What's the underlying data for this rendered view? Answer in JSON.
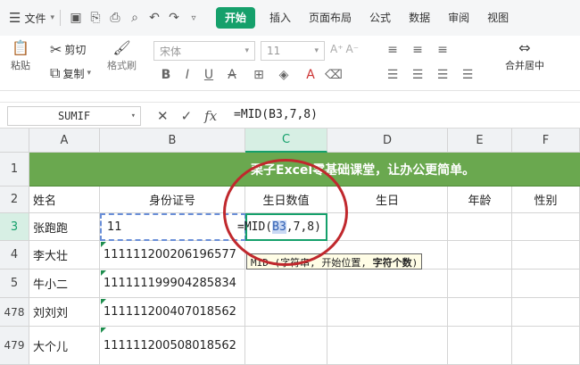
{
  "menu": {
    "file_label": "文件",
    "tabs": [
      "开始",
      "插入",
      "页面布局",
      "公式",
      "数据",
      "审阅",
      "视图"
    ],
    "active_tab": "开始"
  },
  "ribbon": {
    "paste": "粘贴",
    "cut": "剪切",
    "copy": "复制",
    "format_painter": "格式刷",
    "font_name": "宋体",
    "font_size": "11",
    "merge_center": "合并居中"
  },
  "formula_bar": {
    "name_box": "SUMIF",
    "formula": "=MID(B3,7,8)"
  },
  "columns": [
    "A",
    "B",
    "C",
    "D",
    "E",
    "F"
  ],
  "rows": [
    "1",
    "2",
    "3",
    "4",
    "5",
    "478",
    "479"
  ],
  "banner_text": "栗子Excel零基础课堂，让办公更简单。",
  "header_row": {
    "name": "姓名",
    "id": "身份证号",
    "birth_value": "生日数值",
    "birthday": "生日",
    "age": "年龄",
    "gender": "性别"
  },
  "data_rows": [
    {
      "name": "张跑跑",
      "id": "11"
    },
    {
      "name": "李大壮",
      "id": "111111200206196577"
    },
    {
      "name": "牛小二",
      "id": "111111199904285834"
    },
    {
      "name": "刘刘刘",
      "id": "111111200407018562"
    },
    {
      "name": "大个儿",
      "id": "111111200508018562"
    }
  ],
  "edit": {
    "prefix": "=MID(",
    "ref": "B3",
    "suffix": ",7,8)"
  },
  "tooltip": {
    "text": "MID (字符串, 开始位置, ",
    "bold": "字符个数",
    "end": ")"
  },
  "colors": {
    "accent": "#15a06b",
    "banner": "#6aa84f",
    "annotation_circle": "#c0282d"
  }
}
